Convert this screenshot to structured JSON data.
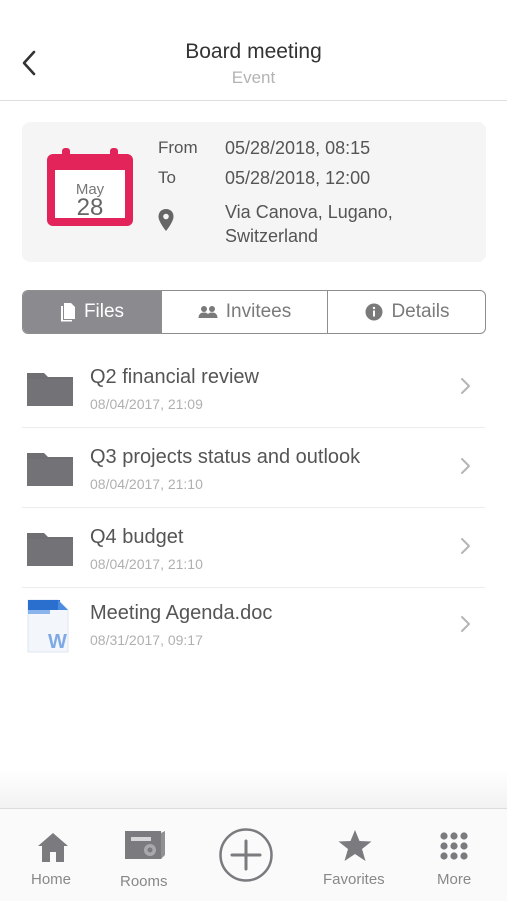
{
  "header": {
    "title": "Board meeting",
    "subtitle": "Event"
  },
  "event": {
    "calendar": {
      "month": "May",
      "day": "28"
    },
    "from_label": "From",
    "from_value": "05/28/2018, 08:15",
    "to_label": "To",
    "to_value": "05/28/2018, 12:00",
    "location_line1": "Via Canova, Lugano,",
    "location_line2": "Switzerland"
  },
  "tabs": [
    {
      "label": "Files",
      "icon": "file-icon",
      "active": true
    },
    {
      "label": "Invitees",
      "icon": "people-icon",
      "active": false
    },
    {
      "label": "Details",
      "icon": "info-icon",
      "active": false
    }
  ],
  "files": [
    {
      "name": "Q2 financial review",
      "date": "08/04/2017, 21:09",
      "icon": "folder-icon"
    },
    {
      "name": "Q3 projects status and outlook",
      "date": "08/04/2017, 21:10",
      "icon": "folder-icon"
    },
    {
      "name": "Q4 budget",
      "date": "08/04/2017, 21:10",
      "icon": "folder-icon"
    },
    {
      "name": "Meeting Agenda.doc",
      "date": "08/31/2017, 09:17",
      "icon": "word-doc-icon"
    }
  ],
  "tabbar": {
    "home": "Home",
    "rooms": "Rooms",
    "favorites": "Favorites",
    "more": "More"
  },
  "colors": {
    "calendar_accent": "#e2245a",
    "tab_active_bg": "#8a8a8f",
    "icon_gray": "#6e6e73"
  }
}
